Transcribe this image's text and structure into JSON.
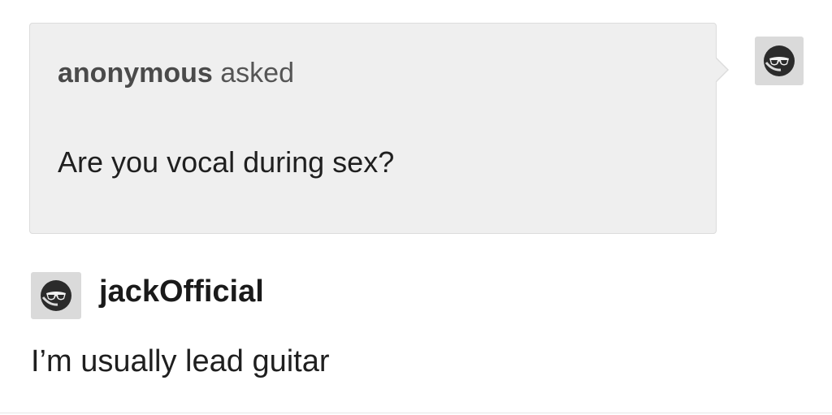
{
  "ask": {
    "asker_name": "anonymous",
    "asked_label": " asked",
    "question": "Are you vocal during sex?"
  },
  "answer": {
    "username": "jackOfficial",
    "text": "I’m usually lead guitar"
  },
  "icons": {
    "avatar": "sunglasses-face-icon"
  },
  "colors": {
    "bubble_bg": "#efefef",
    "bubble_border": "#dcdcdc",
    "avatar_bg": "#dadada",
    "text": "#1f1f1f"
  }
}
